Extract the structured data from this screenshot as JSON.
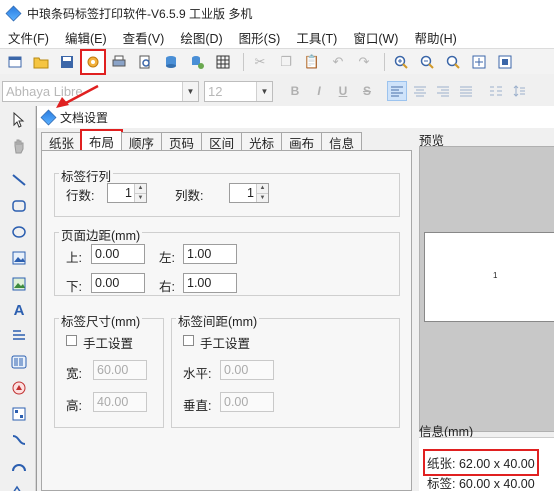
{
  "window": {
    "title": "中琅条码标签打印软件-V6.5.9 工业版 多机"
  },
  "menubar": [
    "文件(F)",
    "编辑(E)",
    "查看(V)",
    "绘图(D)",
    "图形(S)",
    "工具(T)",
    "窗口(W)",
    "帮助(H)"
  ],
  "toolbar": {
    "icons": [
      "new-icon",
      "open-icon",
      "save-icon",
      "settings-icon",
      "print-icon",
      "print-preview-icon",
      "database-icon",
      "database-settings-icon",
      "grid-icon",
      "cut-icon",
      "copy-icon",
      "paste-icon",
      "undo-icon",
      "redo-icon",
      "zoom-in-icon",
      "zoom-out-icon",
      "zoom-fit-icon",
      "zoom-width-icon",
      "zoom-page-icon"
    ],
    "highlighted": "settings-icon"
  },
  "fontbar": {
    "font_value": "Abhaya Libre",
    "size_value": "12",
    "bold": "B",
    "italic": "I",
    "underline": "U",
    "strike": "S"
  },
  "dialog": {
    "title": "文档设置",
    "tabs": [
      "纸张",
      "布局",
      "顺序",
      "页码",
      "区间",
      "光标",
      "画布",
      "信息"
    ],
    "active_tab": "布局",
    "label_rows_cols": {
      "legend": "标签行列",
      "rows_label": "行数:",
      "rows_value": "1",
      "cols_label": "列数:",
      "cols_value": "1"
    },
    "margins": {
      "legend": "页面边距(mm)",
      "top_label": "上:",
      "top_value": "0.00",
      "left_label": "左:",
      "left_value": "1.00",
      "bottom_label": "下:",
      "bottom_value": "0.00",
      "right_label": "右:",
      "right_value": "1.00"
    },
    "label_size": {
      "legend": "标签尺寸(mm)",
      "manual_label": "手工设置",
      "manual_checked": false,
      "width_label": "宽:",
      "width_value": "60.00",
      "height_label": "高:",
      "height_value": "40.00"
    },
    "label_gap": {
      "legend": "标签间距(mm)",
      "manual_label": "手工设置",
      "manual_checked": false,
      "h_label": "水平:",
      "h_value": "0.00",
      "v_label": "垂直:",
      "v_value": "0.00"
    },
    "preview": {
      "title": "预览",
      "label_text": "1"
    },
    "info": {
      "title": "信息(mm)",
      "paper": "纸张: 62.00 x 40.00",
      "label": "标签: 60.00 x 40.00"
    }
  },
  "colors": {
    "accent": "#e02020",
    "icon_blue": "#2c5fb0"
  }
}
